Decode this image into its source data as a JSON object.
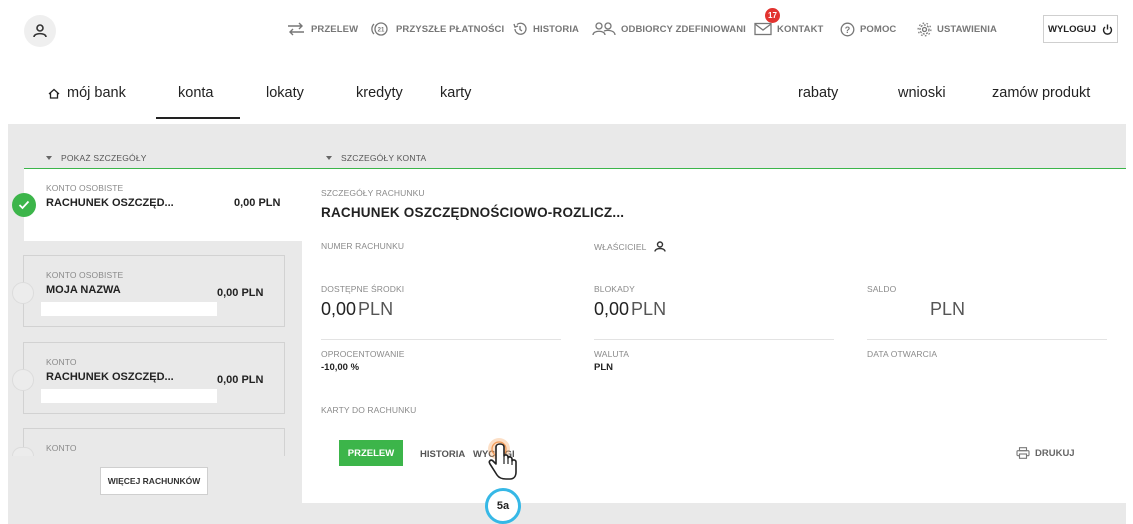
{
  "topnav": {
    "przelew": "PRZELEW",
    "przyszle": "PRZYSZŁE PŁATNOŚCI",
    "historia": "HISTORIA",
    "odbiorcy": "ODBIORCY ZDEFINIOWANI",
    "kontakt": "KONTAKT",
    "kontakt_badge": "17",
    "pomoc": "POMOC",
    "ustawienia": "USTAWIENIA",
    "wyloguj": "WYLOGUJ"
  },
  "mainnav": {
    "home": "mój bank",
    "konta": "konta",
    "lokaty": "lokaty",
    "kredyty": "kredyty",
    "karty": "karty",
    "rabaty": "rabaty",
    "wnioski": "wnioski",
    "zamow": "zamów produkt"
  },
  "left": {
    "header": "POKAŻ SZCZEGÓŁY",
    "accounts": [
      {
        "type": "KONTO OSOBISTE",
        "name": "RACHUNEK OSZCZĘD...",
        "amount": "0,00 PLN",
        "selected": true
      },
      {
        "type": "KONTO OSOBISTE",
        "name": "MOJA NAZWA",
        "amount": "0,00 PLN",
        "selected": false
      },
      {
        "type": "KONTO",
        "name": "RACHUNEK OSZCZĘD...",
        "amount": "0,00 PLN",
        "selected": false
      },
      {
        "type": "KONTO",
        "name": "",
        "amount": "",
        "selected": false
      }
    ],
    "more_button": "WIĘCEJ RACHUNKÓW"
  },
  "details": {
    "header": "SZCZEGÓŁY KONTA",
    "section_label": "SZCZEGÓŁY RACHUNKU",
    "account_title": "RACHUNEK OSZCZĘDNOŚCIOWO-ROZLICZ...",
    "numer_label": "NUMER RACHUNKU",
    "wlasciciel_label": "WŁAŚCICIEL",
    "dostepne_label": "DOSTĘPNE ŚRODKI",
    "dostepne_value": "0,00",
    "dostepne_unit": "PLN",
    "blokady_label": "BLOKADY",
    "blokady_value": "0,00",
    "blokady_unit": "PLN",
    "saldo_label": "SALDO",
    "saldo_unit": "PLN",
    "oprocentowanie_label": "OPROCENTOWANIE",
    "oprocentowanie_value": "-10,00 %",
    "waluta_label": "WALUTA",
    "waluta_value": "PLN",
    "data_label": "DATA OTWARCIA",
    "karty_label": "KARTY DO RACHUNKU",
    "btn_przelew": "PRZELEW",
    "link_historia": "HISTORIA",
    "link_wyciagi": "WYCIĄGI",
    "print": "DRUKUJ"
  },
  "annotation": {
    "step": "5a",
    "color": "#36b8e6"
  },
  "colors": {
    "accent_green": "#3cb54a",
    "badge_red": "#e2332f",
    "panel_bg": "#e9e9e9"
  }
}
